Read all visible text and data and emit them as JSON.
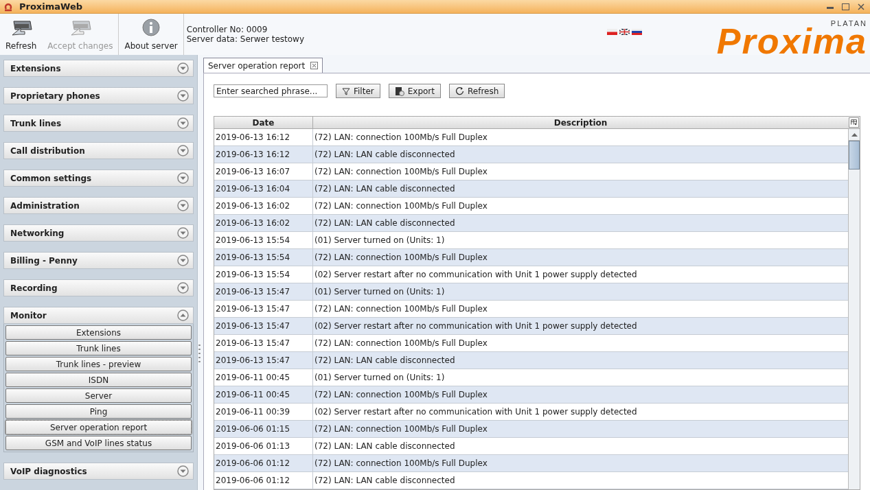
{
  "window": {
    "title": "ProximaWeb"
  },
  "toolbar": [
    {
      "kind": "refresh",
      "label": "Refresh",
      "disabled": false
    },
    {
      "kind": "accept",
      "label": "Accept changes",
      "disabled": true
    },
    {
      "kind": "info",
      "label": "About server",
      "disabled": false
    }
  ],
  "controller_info": [
    "Controller No: 0009",
    "Server data: Serwer testowy"
  ],
  "logo": {
    "brand": "PLATAN",
    "name": "Proxima"
  },
  "sidebar": [
    {
      "label": "Extensions",
      "expanded": false
    },
    {
      "label": "Proprietary phones",
      "expanded": false
    },
    {
      "label": "Trunk lines",
      "expanded": false
    },
    {
      "label": "Call distribution",
      "expanded": false
    },
    {
      "label": "Common settings",
      "expanded": false
    },
    {
      "label": "Administration",
      "expanded": false
    },
    {
      "label": "Networking",
      "expanded": false
    },
    {
      "label": "Billing - Penny",
      "expanded": false
    },
    {
      "label": "Recording",
      "expanded": false
    },
    {
      "label": "Monitor",
      "expanded": true,
      "items": [
        {
          "label": "Extensions",
          "selected": false
        },
        {
          "label": "Trunk lines",
          "selected": false
        },
        {
          "label": "Trunk lines - preview",
          "selected": false
        },
        {
          "label": "ISDN",
          "selected": false
        },
        {
          "label": "Server",
          "selected": false
        },
        {
          "label": "Ping",
          "selected": false
        },
        {
          "label": "Server operation report",
          "selected": true
        },
        {
          "label": "GSM and VoIP lines status",
          "selected": false
        }
      ]
    },
    {
      "label": "VoIP diagnostics",
      "expanded": false
    }
  ],
  "tabs": [
    {
      "label": "Server operation report",
      "selected": true
    }
  ],
  "search": {
    "placeholder": "Enter searched phrase..."
  },
  "actions": [
    {
      "kind": "filter",
      "label": "Filter"
    },
    {
      "kind": "export",
      "label": "Export"
    },
    {
      "kind": "refresh",
      "label": "Refresh"
    }
  ],
  "table": {
    "columns": [
      "Date",
      "Description"
    ],
    "rows": [
      [
        "2019-06-13 16:12",
        "(72) LAN: connection 100Mb/s Full Duplex"
      ],
      [
        "2019-06-13 16:12",
        "(72) LAN: LAN cable disconnected"
      ],
      [
        "2019-06-13 16:07",
        "(72) LAN: connection 100Mb/s Full Duplex"
      ],
      [
        "2019-06-13 16:04",
        "(72) LAN: LAN cable disconnected"
      ],
      [
        "2019-06-13 16:02",
        "(72) LAN: connection 100Mb/s Full Duplex"
      ],
      [
        "2019-06-13 16:02",
        "(72) LAN: LAN cable disconnected"
      ],
      [
        "2019-06-13 15:54",
        "(01) Server turned on (Units: 1)"
      ],
      [
        "2019-06-13 15:54",
        "(72) LAN: connection 100Mb/s Full Duplex"
      ],
      [
        "2019-06-13 15:54",
        "(02) Server restart after no communication with Unit 1 power supply detected"
      ],
      [
        "2019-06-13 15:47",
        "(01) Server turned on (Units: 1)"
      ],
      [
        "2019-06-13 15:47",
        "(72) LAN: connection 100Mb/s Full Duplex"
      ],
      [
        "2019-06-13 15:47",
        "(02) Server restart after no communication with Unit 1 power supply detected"
      ],
      [
        "2019-06-13 15:47",
        "(72) LAN: connection 100Mb/s Full Duplex"
      ],
      [
        "2019-06-13 15:47",
        "(72) LAN: LAN cable disconnected"
      ],
      [
        "2019-06-11 00:45",
        "(01) Server turned on (Units: 1)"
      ],
      [
        "2019-06-11 00:45",
        "(72) LAN: connection 100Mb/s Full Duplex"
      ],
      [
        "2019-06-11 00:39",
        "(02) Server restart after no communication with Unit 1 power supply detected"
      ],
      [
        "2019-06-06 01:15",
        "(72) LAN: connection 100Mb/s Full Duplex"
      ],
      [
        "2019-06-06 01:13",
        "(72) LAN: LAN cable disconnected"
      ],
      [
        "2019-06-06 01:12",
        "(72) LAN: connection 100Mb/s Full Duplex"
      ],
      [
        "2019-06-06 01:12",
        "(72) LAN: LAN cable disconnected"
      ]
    ]
  }
}
